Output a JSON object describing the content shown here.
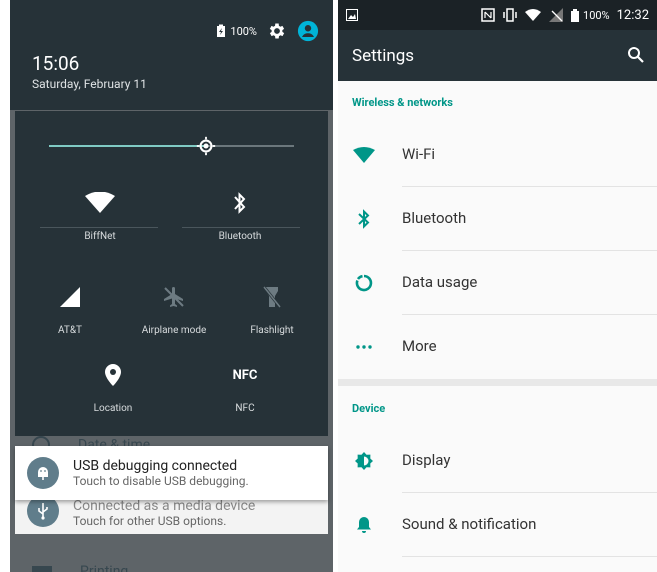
{
  "shade": {
    "battery": "100%",
    "time": "15:06",
    "date": "Saturday, February 11",
    "brightness": 0.64,
    "tiles": [
      {
        "label": "BiffNet",
        "icon": "wifi-icon"
      },
      {
        "label": "Bluetooth",
        "icon": "bluetooth-icon"
      },
      {
        "label": "AT&T",
        "icon": "cellular-signal-icon"
      },
      {
        "label": "Airplane mode",
        "icon": "airplane-icon"
      },
      {
        "label": "Flashlight",
        "icon": "flashlight-icon"
      },
      {
        "label": "Location",
        "icon": "location-pin-icon"
      },
      {
        "label": "NFC",
        "icon": "nfc-icon"
      }
    ],
    "notifications": [
      {
        "title": "USB debugging connected",
        "body": "Touch to disable USB debugging."
      },
      {
        "title": "Connected as a media device",
        "body": "Touch for other USB options."
      }
    ],
    "background_rows": [
      "Date & time",
      "Printing"
    ]
  },
  "settings": {
    "statusbar": {
      "battery": "100%",
      "time": "12:32"
    },
    "title": "Settings",
    "sections": [
      {
        "header": "Wireless & networks",
        "items": [
          {
            "label": "Wi-Fi",
            "icon": "wifi-icon"
          },
          {
            "label": "Bluetooth",
            "icon": "bluetooth-icon"
          },
          {
            "label": "Data usage",
            "icon": "data-usage-icon"
          },
          {
            "label": "More",
            "icon": "more-dots-icon"
          }
        ]
      },
      {
        "header": "Device",
        "items": [
          {
            "label": "Display",
            "icon": "display-brightness-icon"
          },
          {
            "label": "Sound & notification",
            "icon": "bell-icon"
          }
        ]
      }
    ]
  },
  "colors": {
    "accent": "#009688",
    "dark": "#263238",
    "slider": "#80cbc4"
  }
}
